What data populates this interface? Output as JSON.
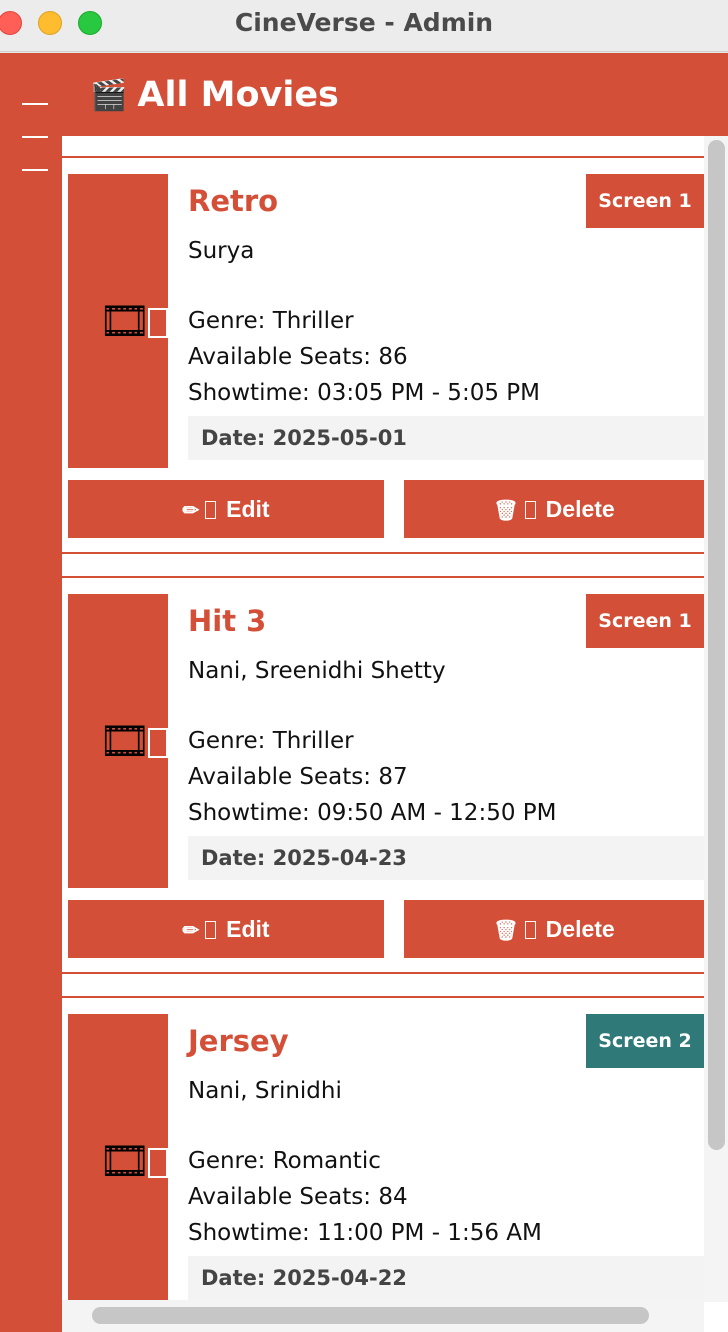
{
  "window": {
    "title": "CineVerse - Admin"
  },
  "header": {
    "icon": "🎬",
    "title": "All Movies"
  },
  "movies": [
    {
      "title": "Retro",
      "cast": "Surya",
      "genre": "Genre: Thriller",
      "seats": "Available Seats: 86",
      "showtime": "Showtime: 03:05 PM - 5:05 PM",
      "date": "Date: 2025-05-01",
      "screen": "Screen 1",
      "screen_color": "#d44f37",
      "poster_icon": "🎞",
      "edit_label": "Edit",
      "delete_label": "Delete"
    },
    {
      "title": "Hit 3",
      "cast": "Nani, Sreenidhi Shetty",
      "genre": "Genre: Thriller",
      "seats": "Available Seats: 87",
      "showtime": "Showtime: 09:50 AM - 12:50 PM",
      "date": "Date: 2025-04-23",
      "screen": "Screen 1",
      "screen_color": "#d44f37",
      "poster_icon": "🎞",
      "edit_label": "Edit",
      "delete_label": "Delete"
    },
    {
      "title": "Jersey",
      "cast": "Nani, Srinidhi",
      "genre": "Genre: Romantic",
      "seats": "Available Seats: 84",
      "showtime": "Showtime: 11:00 PM - 1:56 AM",
      "date": "Date: 2025-04-22",
      "screen": "Screen 2",
      "screen_color": "#2f7a78",
      "poster_icon": "🎞",
      "edit_label": "Edit",
      "delete_label": "Delete"
    }
  ],
  "icons": {
    "edit": "✏",
    "delete": "🗑"
  }
}
